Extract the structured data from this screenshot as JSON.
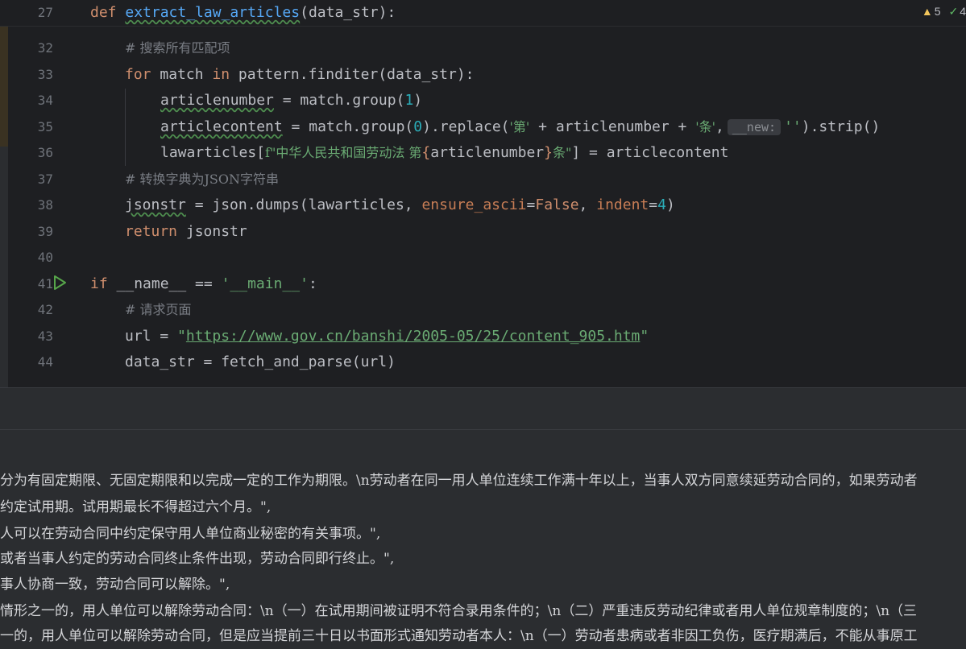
{
  "sticky": {
    "line_number": "27",
    "keyword": "def",
    "function_name": "extract_law_articles",
    "params": "(data_str):",
    "warnings_count": "5",
    "ok_count": "4"
  },
  "code_lines": [
    {
      "n": "32",
      "t": "# 搜索所有匹配项"
    },
    {
      "n": "33",
      "t": "for match in pattern.finditer(data_str):"
    },
    {
      "n": "34",
      "t": "articlenumber = match.group(1)"
    },
    {
      "n": "35",
      "t": "articlecontent = match.group(0).replace('第' + articlenumber + '条', __new: '').strip()"
    },
    {
      "n": "36",
      "t": "lawarticles[f\"中华人民共和国劳动法 第{articlenumber}条\"] = articlecontent"
    },
    {
      "n": "37",
      "t": "# 转换字典为JSON字符串"
    },
    {
      "n": "38",
      "t": "jsonstr = json.dumps(lawarticles, ensure_ascii=False, indent=4)"
    },
    {
      "n": "39",
      "t": "return jsonstr"
    },
    {
      "n": "40",
      "t": ""
    },
    {
      "n": "41",
      "t": "if __name__ == '__main__':"
    },
    {
      "n": "42",
      "t": "# 请求页面"
    },
    {
      "n": "43",
      "t": "url = \"https://www.gov.cn/banshi/2005-05/25/content_905.htm\""
    },
    {
      "n": "44",
      "t": "data_str = fetch_and_parse(url)"
    }
  ],
  "tokens": {
    "cm32": "# 搜索所有匹配项",
    "kw_for": "for",
    "kw_in": "in",
    "l33_a": " match ",
    "l33_b": " pattern.finditer(data_str):",
    "l34_var": "articlenumber",
    "l34_a": " = match.group(",
    "l34_num": "1",
    "l34_b": ")",
    "l35_var": "articlecontent",
    "l35_a": " = match.group(",
    "l35_num": "0",
    "l35_b": ").replace(",
    "l35_s1": "'第'",
    "l35_c": " + articlenumber + ",
    "l35_s2": "'条'",
    "l35_d": ",",
    "l35_hint": "__new:",
    "l35_s3": "''",
    "l35_e": ").strip()",
    "l36_a": "lawarticles[",
    "l36_f": "f\"中华人民共和国劳动法 第",
    "l36_b": "{",
    "l36_c": "articlenumber",
    "l36_d": "}",
    "l36_s": "条\"",
    "l36_e": "] = articlecontent",
    "cm37": "# 转换字典为JSON字符串",
    "l38_var": "jsonstr",
    "l38_a": " = json.dumps(lawarticles, ",
    "l38_p1": "ensure_ascii",
    "l38_eq1": "=",
    "l38_false": "False",
    "l38_c": ", ",
    "l38_p2": "indent",
    "l38_eq2": "=",
    "l38_num": "4",
    "l38_e": ")",
    "kw_return": "return",
    "l39_a": " jsonstr",
    "kw_if": "if",
    "l41_a": " __name__ == ",
    "l41_s": "'__main__'",
    "l41_b": ":",
    "cm42": "# 请求页面",
    "l43_a": "url = ",
    "l43_q1": "\"",
    "l43_url": "https://www.gov.cn/banshi/2005-05/25/content_905.htm",
    "l43_q2": "\"",
    "l44_a": "data_str = fetch_and_parse(url)"
  },
  "output_lines": [
    "分为有固定期限、无固定期限和以完成一定的工作为期限。\\n劳动者在同一用人单位连续工作满十年以上，当事人双方同意续延劳动合同的，如果劳动者",
    "约定试用期。试用期最长不得超过六个月。\",",
    "人可以在劳动合同中约定保守用人单位商业秘密的有关事项。\",",
    "或者当事人约定的劳动合同终止条件出现，劳动合同即行终止。\",",
    "事人协商一致，劳动合同可以解除。\",",
    "情形之一的，用人单位可以解除劳动合同：\\n（一）在试用期间被证明不符合录用条件的；\\n（二）严重违反劳动纪律或者用人单位规章制度的；\\n（三",
    "一的，用人单位可以解除劳动合同，但是应当提前三十日以书面形式通知劳动者本人：\\n（一）劳动者患病或者非因工负伤，医疗期满后，不能从事原工"
  ]
}
